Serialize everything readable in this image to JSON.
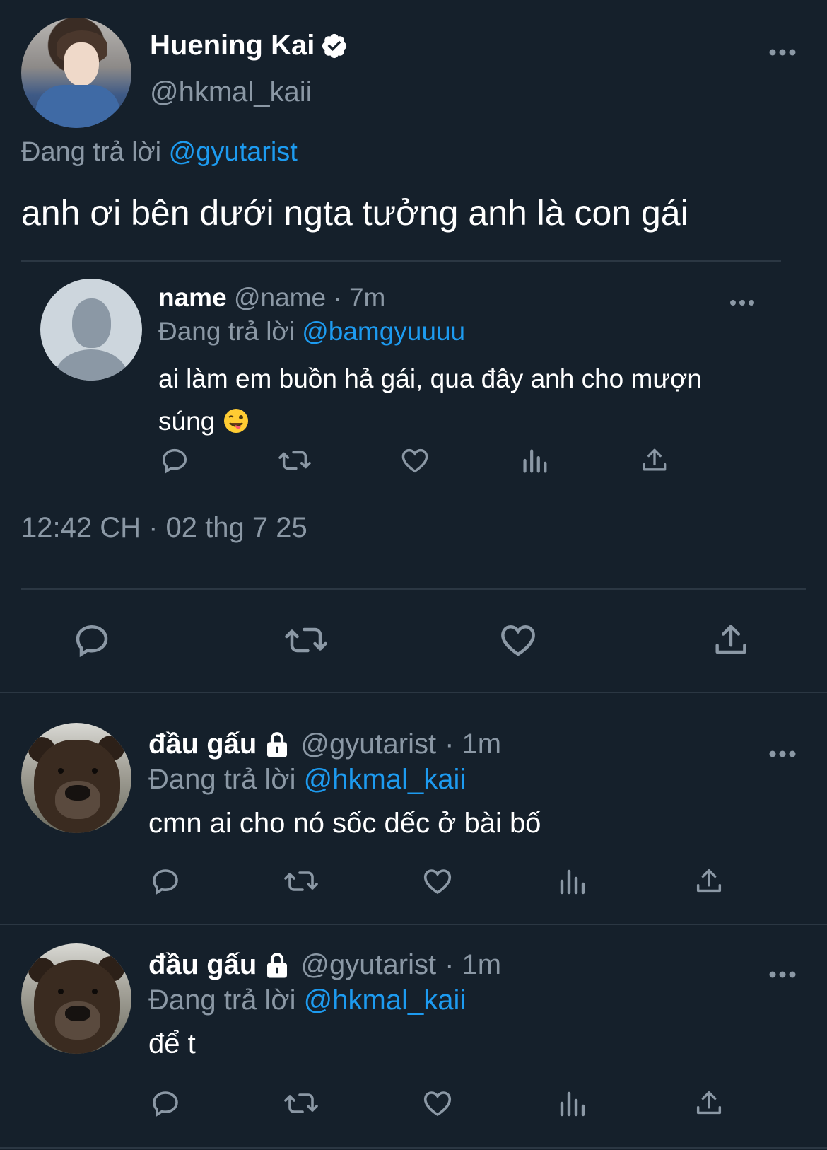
{
  "main_tweet": {
    "author_name": "Huening Kai",
    "author_handle": "@hkmal_kaii",
    "replying_prefix": "Đang trả lời",
    "replying_to": "@gyutarist",
    "text": "anh ơi bên dưới ngta tưởng anh là con gái",
    "timestamp": "12:42 CH · 02 thg 7 25",
    "icons": [
      "verified-icon",
      "more-icon",
      "reply-icon",
      "retweet-icon",
      "like-icon",
      "share-icon"
    ]
  },
  "quoted_tweet": {
    "author_name": "name",
    "author_handle": "@name",
    "time": "· 7m",
    "replying_prefix": "Đang trả lời",
    "replying_to": "@bamgyuuuu",
    "text": "ai làm em buồn hả gái, qua đây anh cho mượn súng",
    "emoji": "winking-face-with-tongue"
  },
  "replies": [
    {
      "author_name": "đầu gấu",
      "author_handle": "@gyutarist",
      "time": "· 1m",
      "replying_prefix": "Đang trả lời",
      "replying_to": "@hkmal_kaii",
      "text": "cmn ai cho nó sốc dếc ở bài bố"
    },
    {
      "author_name": "đầu gấu",
      "author_handle": "@gyutarist",
      "time": "· 1m",
      "replying_prefix": "Đang trả lời",
      "replying_to": "@hkmal_kaii",
      "text": "để t"
    }
  ],
  "colors": {
    "background": "#15202b",
    "text": "#ffffff",
    "secondary": "#8b98a5",
    "accent": "#1d9bf0",
    "divider": "#2b3743"
  }
}
